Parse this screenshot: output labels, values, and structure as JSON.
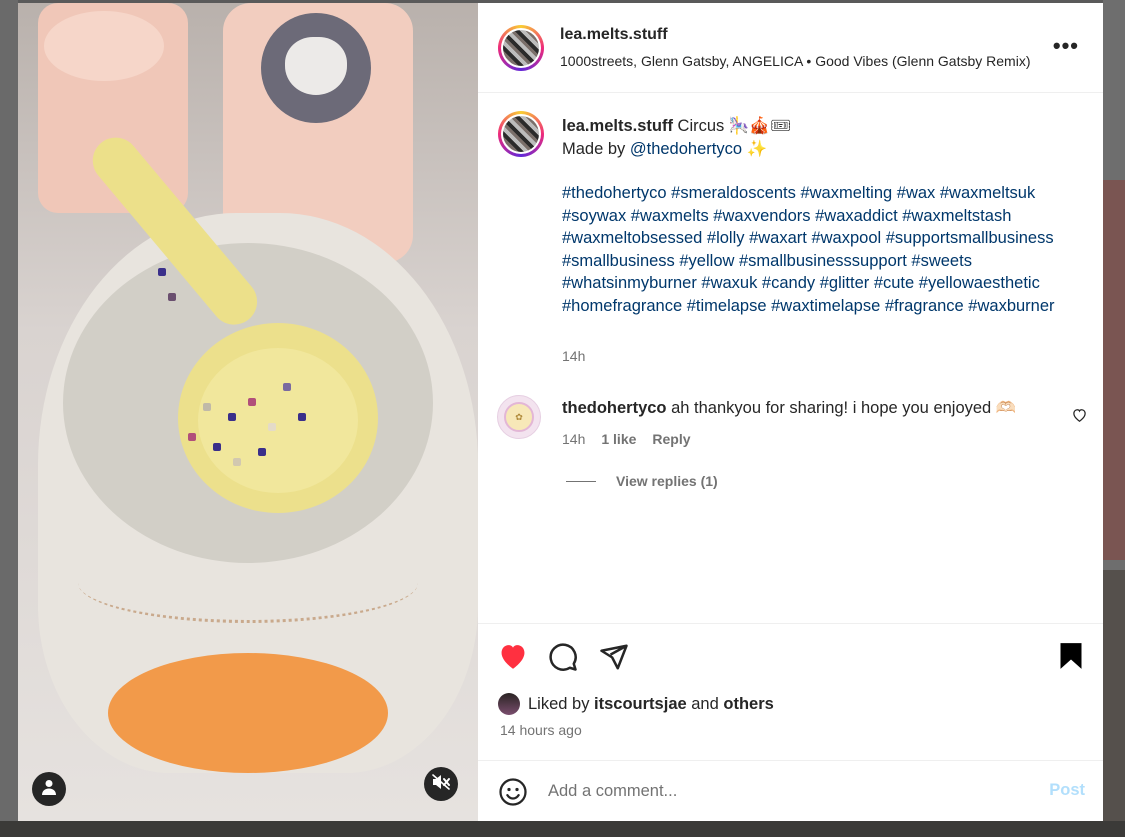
{
  "post": {
    "username": "lea.melts.stuff",
    "audio": "1000streets, Glenn Gatsby, ANGELICA • Good Vibes (Glenn Gatsby Remix)",
    "more_icon": "more-horizontal-icon"
  },
  "caption": {
    "username": "lea.melts.stuff",
    "title_text": " Circus 🎠🎪🎟",
    "made_by_prefix": "Made by ",
    "made_by_handle": "@thedohertyco",
    "made_by_suffix": " ✨",
    "hashtags": "#thedohertyco #smeraldoscents #waxmelting #wax #waxmeltsuk #soywax #waxmelts #waxvendors #waxaddict #waxmeltstash #waxmeltobsessed #lolly #waxart #waxpool #supportsmallbusiness #smallbusiness #yellow #smallbusinesssupport #sweets #whatsinmyburner #waxuk #candy #glitter #cute #yellowaesthetic #homefragrance #timelapse #waxtimelapse #fragrance #waxburner",
    "time": "14h"
  },
  "comment": {
    "username": "thedohertyco",
    "text": " ah thankyou for sharing! i hope you enjoyed 🫶🏻",
    "time": "14h",
    "likes": "1 like",
    "reply_label": "Reply",
    "view_replies": "View replies (1)"
  },
  "actions": {
    "liked": true,
    "saved": true,
    "liked_by_prefix": "Liked by ",
    "liked_by_user": "itscourtsjae",
    "liked_by_mid": " and ",
    "liked_by_others": "others",
    "timestamp": "14 hours ago"
  },
  "compose": {
    "placeholder": "Add a comment...",
    "post_label": "Post"
  },
  "colors": {
    "like_red": "#ff3040",
    "link_blue": "#00376b",
    "post_disabled": "#b2dffc"
  }
}
